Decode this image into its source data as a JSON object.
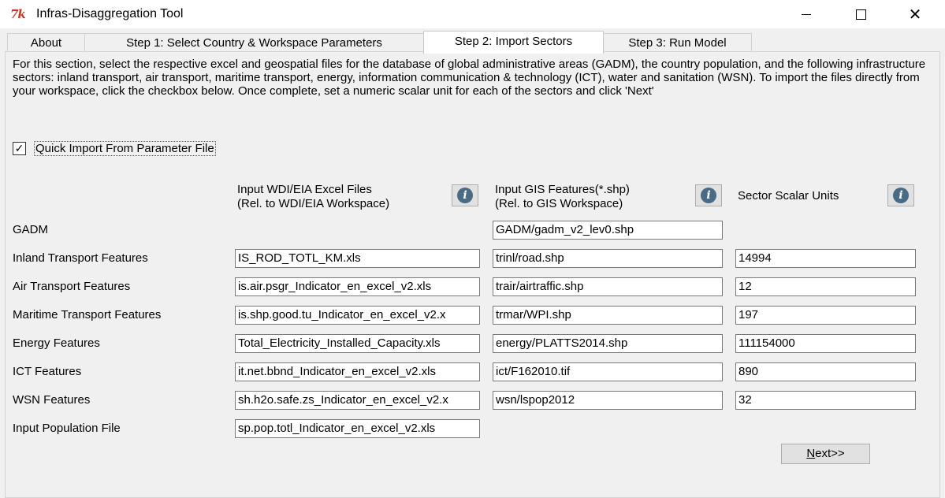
{
  "window": {
    "title": "Infras-Disaggregation Tool",
    "app_icon_text": "7k",
    "minimize_icon": "minimize-icon",
    "maximize_icon": "maximize-icon",
    "close_icon": "close-icon",
    "close_glyph": "✕"
  },
  "tabs": [
    {
      "label": "About"
    },
    {
      "label": "Step 1: Select Country & Workspace Parameters"
    },
    {
      "label": "Step 2: Import Sectors",
      "active": true
    },
    {
      "label": "Step 3: Run Model"
    }
  ],
  "description": "For this section, select the respective excel and geospatial files for the database of global administrative areas (GADM), the country population, and the following infrastructure sectors: inland transport, air transport, maritime transport, energy, information communication & technology (ICT), water and sanitation (WSN). To import the files directly from your workspace, click the checkbox below. Once complete, set a numeric scalar unit for each of the sectors and click 'Next'",
  "quick_import": {
    "label": "Quick Import From Parameter File",
    "checked": true,
    "check_glyph": "✓"
  },
  "columns": {
    "excel": {
      "line1": "Input WDI/EIA Excel Files",
      "line2": "(Rel. to WDI/EIA Workspace)"
    },
    "gis": {
      "line1": "Input GIS Features(*.shp)",
      "line2": "(Rel. to GIS Workspace)"
    },
    "scalar": {
      "line1": "Sector Scalar Units"
    },
    "info_glyph": "i",
    "info_icon": "info-icon"
  },
  "rows": {
    "gadm": {
      "label": "GADM",
      "gis": "GADM/gadm_v2_lev0.shp"
    },
    "inland": {
      "label": "Inland Transport Features",
      "excel": "IS_ROD_TOTL_KM.xls",
      "gis": "trinl/road.shp",
      "scalar": "14994"
    },
    "air": {
      "label": "Air Transport Features",
      "excel": "is.air.psgr_Indicator_en_excel_v2.xls",
      "gis": "trair/airtraffic.shp",
      "scalar": "12"
    },
    "maritime": {
      "label": "Maritime Transport Features",
      "excel": "is.shp.good.tu_Indicator_en_excel_v2.x",
      "gis": "trmar/WPI.shp",
      "scalar": "197"
    },
    "energy": {
      "label": "Energy Features",
      "excel": "Total_Electricity_Installed_Capacity.xls",
      "gis": "energy/PLATTS2014.shp",
      "scalar": "111154000"
    },
    "ict": {
      "label": "ICT Features",
      "excel": "it.net.bbnd_Indicator_en_excel_v2.xls",
      "gis": "ict/F162010.tif",
      "scalar": "890"
    },
    "wsn": {
      "label": "WSN Features",
      "excel": "sh.h2o.safe.zs_Indicator_en_excel_v2.x",
      "gis": "wsn/lspop2012",
      "scalar": "32"
    },
    "population": {
      "label": "Input Population File",
      "excel": "sp.pop.totl_Indicator_en_excel_v2.xls"
    }
  },
  "next_button": {
    "mnemonic": "N",
    "rest": "ext>>"
  }
}
